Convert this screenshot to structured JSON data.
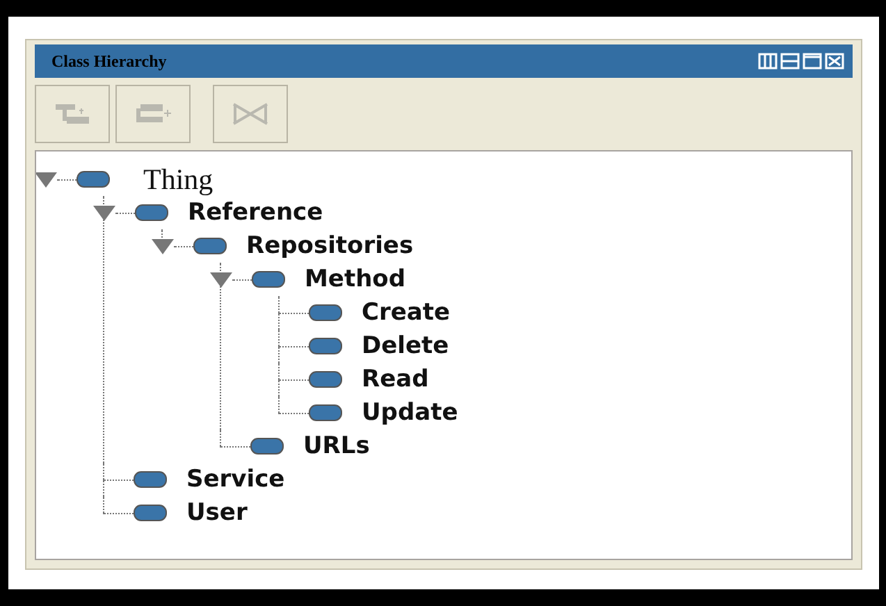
{
  "panel": {
    "title": "Class Hierarchy"
  },
  "toolbar": [
    {
      "kind": "add-child",
      "disabled": true
    },
    {
      "kind": "add-sibling",
      "disabled": true
    },
    {
      "kind": "delete",
      "disabled": true
    }
  ],
  "tree": [
    {
      "label": "Thing",
      "expanded": true,
      "children": [
        {
          "label": "Reference",
          "expanded": true,
          "children": [
            {
              "label": "Repositories",
              "expanded": true,
              "children": [
                {
                  "label": "Method",
                  "expanded": true,
                  "children": [
                    {
                      "label": "Create"
                    },
                    {
                      "label": "Delete"
                    },
                    {
                      "label": "Read"
                    },
                    {
                      "label": "Update"
                    }
                  ]
                },
                {
                  "label": "URLs"
                }
              ]
            }
          ]
        },
        {
          "label": "Service"
        },
        {
          "label": "User"
        }
      ]
    }
  ]
}
